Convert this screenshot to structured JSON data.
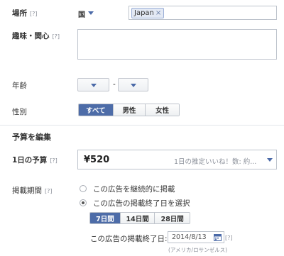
{
  "location": {
    "label": "場所",
    "help": "[?]",
    "scope_value": "国",
    "token": "Japan",
    "token_remove": "×"
  },
  "interests": {
    "label": "趣味・関心",
    "help": "[?]"
  },
  "age": {
    "label": "年齢",
    "min_value": "",
    "max_value": "",
    "separator": "-"
  },
  "gender": {
    "label": "性別",
    "options": [
      "すべて",
      "男性",
      "女性"
    ],
    "selected": "すべて"
  },
  "budget_section": {
    "title": "予算を編集"
  },
  "daily_budget": {
    "label": "1日の予算",
    "help": "[?]",
    "amount": "¥520",
    "estimate": "1日の推定いいね！数: 約..."
  },
  "schedule": {
    "label": "掲載期間",
    "help": "[?]",
    "option_continuous": "この広告を継続的に掲載",
    "option_end_date": "この広告の掲載終了日を選択",
    "selected_option": "end_date",
    "durations": [
      "7日間",
      "14日間",
      "28日間"
    ],
    "selected_duration": "7日間",
    "end_date_label": "この広告の掲載終了日:",
    "end_date_value": "2014/8/13",
    "end_date_help": "[?]",
    "timezone": "(アメリカ/ロサンゼルス)"
  },
  "colors": {
    "accent": "#4d6ca8",
    "caret": "#4b6aa8"
  },
  "icons": {
    "calendar": "calendar-icon",
    "dropdown": "chevron-down-icon"
  }
}
